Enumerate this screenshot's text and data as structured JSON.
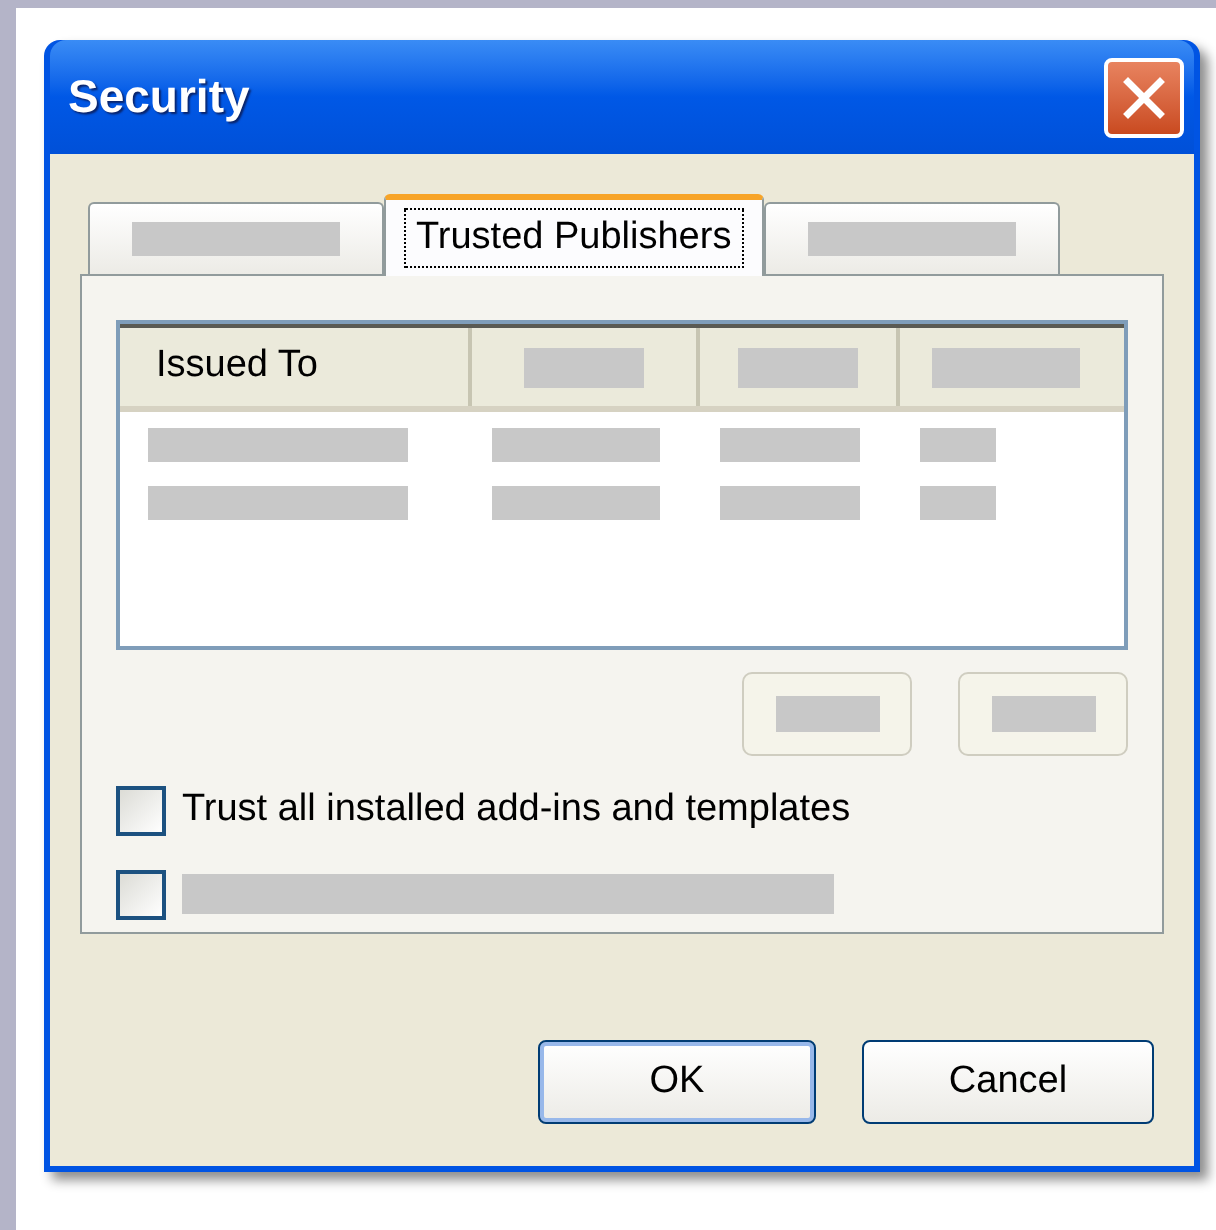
{
  "window": {
    "title": "Security"
  },
  "tabs": [
    {
      "redacted": true,
      "selected": false
    },
    {
      "label": "Trusted Publishers",
      "redacted": false,
      "selected": true
    },
    {
      "redacted": true,
      "selected": false
    }
  ],
  "table": {
    "columns": [
      {
        "label": "Issued To",
        "redacted": false
      },
      {
        "redacted": true
      },
      {
        "redacted": true
      },
      {
        "redacted": true
      }
    ],
    "rows": [
      {
        "cells": [
          {
            "redacted": true
          },
          {
            "redacted": true
          },
          {
            "redacted": true
          },
          {
            "redacted": true
          }
        ]
      },
      {
        "cells": [
          {
            "redacted": true
          },
          {
            "redacted": true
          },
          {
            "redacted": true
          },
          {
            "redacted": true
          }
        ]
      }
    ]
  },
  "list_buttons": [
    {
      "redacted": true
    },
    {
      "redacted": true
    }
  ],
  "checkboxes": [
    {
      "label": "Trust all installed add-ins and templates",
      "redacted": false,
      "checked": false
    },
    {
      "redacted": true,
      "checked": false
    }
  ],
  "buttons": [
    {
      "label": "OK",
      "default": true
    },
    {
      "label": "Cancel",
      "default": false
    }
  ]
}
